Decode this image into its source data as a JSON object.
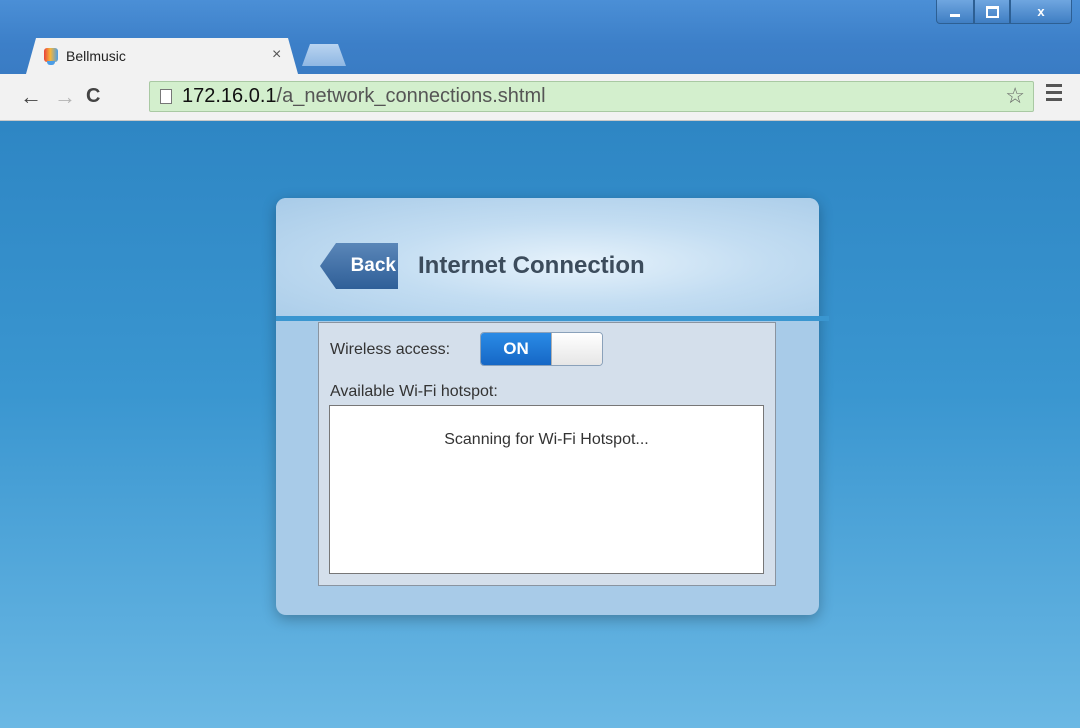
{
  "browser": {
    "tab_title": "Bellmusic",
    "tab_close": "×",
    "url_host": "172.16.0.1",
    "url_path": "/a_network_connections.shtml",
    "window_controls": {
      "close_label": "x"
    }
  },
  "page": {
    "back_label": "Back",
    "title": "Internet Connection",
    "wireless_label": "Wireless access:",
    "wireless_toggle": {
      "state_label": "ON",
      "on": true
    },
    "hotspot_label": "Available Wi-Fi hotspot:",
    "hotspot_status": "Scanning for Wi-Fi Hotspot..."
  },
  "colors": {
    "page_bg": "#3a96d0",
    "card_bg": "#a8cbe8",
    "toggle_on": "#1f7ad8",
    "omnibox_bg": "#d3efcd"
  },
  "icons": [
    "favicon-icon",
    "close-icon",
    "back-arrow-icon",
    "forward-arrow-icon",
    "reload-icon",
    "page-icon",
    "star-icon",
    "menu-icon"
  ]
}
